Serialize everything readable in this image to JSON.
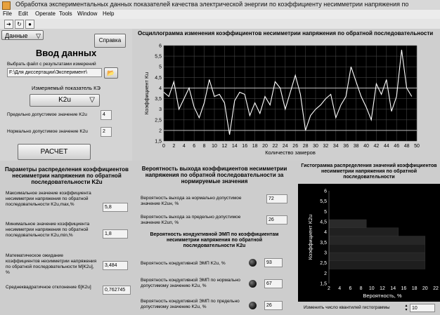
{
  "window": {
    "title": "Обработка экспериментальных данных показателей качества электрической энергии по коэффициенту несимметрии напряжения по"
  },
  "menu": [
    "File",
    "Edit",
    "Operate",
    "Tools",
    "Window",
    "Help"
  ],
  "left": {
    "data_menu": "Данные",
    "help_button": "Справка",
    "title": "Ввод данных",
    "file_label": "Выбрать файл с результатами измерений",
    "file_path": "F:\\Для диссертации\\Эксперимент\\",
    "indicator_label": "Измеряемый показатель КЭ",
    "indicator_value": "K2u",
    "limit_max_label": "Предельно допустимое значение K2u",
    "limit_max_value": "4",
    "limit_norm_label": "Нормально допустимое значение K2u",
    "limit_norm_value": "2",
    "calc_button": "РАСЧЕТ"
  },
  "params": {
    "title": "Параметры распределения коэффициентов несимметрии напряжения по обратной последовательности K2u",
    "max_label": "Максимальное значение коэффициента несимметрии напряжения по обратной последовательности K2u,max,%",
    "max_value": "5,8",
    "min_label": "Минимальное значение коэффициента несимметрии напряжения по обратной последовательности K2u,min,%",
    "min_value": "1,8",
    "mean_label": "Математическое ожидание коэффициентов несимметрии напряжения по обратной последовательности M[K2u], %",
    "mean_value": "3,484",
    "std_label": "Среднеквадратичное отклонение б[K2u]",
    "std_value": "0,762745"
  },
  "prob": {
    "title": "Вероятность выхода коэффициентов несимметрии напряжения по обратной последовательности за нормируемые значения",
    "norm_label": "Вероятность выхода за нормально допустимое значение K2uн, %",
    "norm_value": "72",
    "max_label": "Вероятность выхода за предельно допустимое значение K2uп, %",
    "max_value": "26",
    "emp_title": "Вероятность кондуктивной ЭМП по коэффициентам несимметрии напряжения по обратной последовательности K2u",
    "emp1_label": "Вероятность кондуктивной ЭМП K2u, %",
    "emp1_value": "93",
    "emp2_label": "Вероятность кондуктивной ЭМП по нормально допустимому значению K2u, %",
    "emp2_value": "67",
    "emp3_label": "Вероятность кондуктивной ЭМП по предельно допустимому значению K2u, %",
    "emp3_value": "26"
  },
  "hist": {
    "title": "Гистограмма распределения значений коэффициентов несимметрии напряжения по обратной последовательности",
    "quantile_label": "Изменить число квантилей гистограммы",
    "quantile_value": "10"
  },
  "chart_data": [
    {
      "type": "line",
      "title": "Осциллограмма изменения коэффициентов несимметрии напряжения по обратной последовательности",
      "xlabel": "Количество замеров",
      "ylabel": "Коэффициент Ku",
      "xlim": [
        0,
        50
      ],
      "ylim": [
        1.5,
        6
      ],
      "x_ticks": [
        0,
        2,
        4,
        6,
        8,
        10,
        12,
        14,
        16,
        18,
        20,
        22,
        24,
        26,
        28,
        30,
        32,
        34,
        36,
        38,
        40,
        42,
        44,
        46,
        48,
        50
      ],
      "y_ticks": [
        1.5,
        2,
        2.5,
        3,
        3.5,
        4,
        4.5,
        5,
        5.5,
        6
      ],
      "y_tick_labels": [
        "1,5",
        "2",
        "2,5",
        "3",
        "3,5",
        "4",
        "4,5",
        "5",
        "5,5",
        "6"
      ],
      "reference_lines": [
        2,
        4
      ],
      "x": [
        0,
        1,
        2,
        3,
        4,
        5,
        6,
        7,
        8,
        9,
        10,
        11,
        12,
        13,
        14,
        15,
        16,
        17,
        18,
        19,
        20,
        21,
        22,
        23,
        24,
        25,
        26,
        27,
        28,
        29,
        30,
        31,
        32,
        33,
        34,
        35,
        36,
        37,
        38,
        39,
        40,
        41,
        42,
        43,
        44,
        45,
        46,
        47,
        48,
        49
      ],
      "values": [
        3.8,
        3.6,
        4.3,
        3.0,
        3.5,
        4.0,
        3.1,
        2.6,
        3.3,
        4.4,
        3.6,
        3.7,
        3.3,
        1.8,
        3.4,
        3.8,
        3.7,
        2.7,
        3.3,
        2.8,
        3.6,
        3.2,
        4.3,
        4.0,
        3.0,
        3.8,
        4.6,
        3.7,
        2.0,
        2.7,
        3.0,
        3.2,
        3.5,
        3.7,
        2.6,
        3.2,
        3.6,
        5.0,
        4.3,
        3.6,
        3.1,
        2.5,
        4.2,
        3.7,
        4.4,
        2.9,
        3.6,
        5.8,
        4.0,
        3.6
      ]
    },
    {
      "type": "bar",
      "orientation": "horizontal",
      "xlabel": "Вероятность, %",
      "ylabel": "Коэффициент K2u",
      "xlim": [
        2,
        22
      ],
      "ylim": [
        1.5,
        6
      ],
      "x_ticks": [
        2,
        4,
        6,
        8,
        10,
        12,
        14,
        16,
        18,
        20,
        22
      ],
      "y_ticks": [
        1.5,
        2,
        2.5,
        3,
        3.5,
        4,
        4.5,
        5,
        5.5,
        6
      ],
      "y_tick_labels": [
        "1,5",
        "2",
        "2,5",
        "3",
        "3,5",
        "4",
        "4,5",
        "5",
        "5,5",
        "6"
      ],
      "bins": [
        {
          "from": 2.2,
          "to": 2.6,
          "value": 20
        },
        {
          "from": 2.6,
          "to": 3.0,
          "value": 20
        },
        {
          "from": 3.0,
          "to": 3.4,
          "value": 20
        },
        {
          "from": 3.4,
          "to": 3.8,
          "value": 20
        },
        {
          "from": 3.8,
          "to": 4.2,
          "value": 15
        },
        {
          "from": 4.2,
          "to": 4.6,
          "value": 9
        }
      ]
    }
  ]
}
